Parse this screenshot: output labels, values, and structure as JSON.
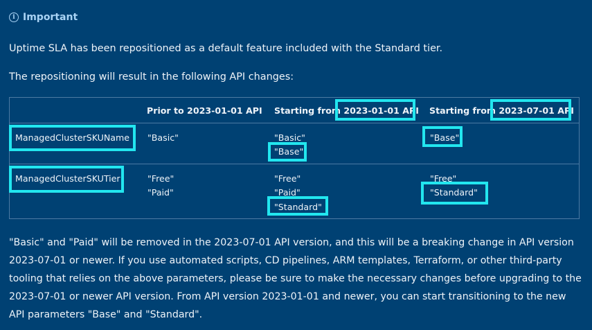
{
  "callout": {
    "icon": "info-circle-icon",
    "title": "Important"
  },
  "intro": "Uptime SLA has been repositioned as a default feature included with the Standard tier.",
  "lead": "The repositioning will result in the following API changes:",
  "table": {
    "headers": [
      "",
      "Prior to 2023-01-01 API",
      "Starting from 2023-01-01 API",
      "Starting from 2023-07-01 API"
    ],
    "header_parts": {
      "col2_prefix": "Starting from ",
      "col2_version": "2023-01-01 API",
      "col3_prefix": "Starting from ",
      "col3_version": "2023-07-01 API"
    },
    "rows": [
      {
        "name": "ManagedClusterSKUName",
        "prior": [
          "\"Basic\""
        ],
        "from_2023_01_01": [
          "\"Basic\"",
          "\"Base\""
        ],
        "from_2023_07_01": [
          "\"Base\""
        ]
      },
      {
        "name": "ManagedClusterSKUTier",
        "prior": [
          "\"Free\"",
          "\"Paid\""
        ],
        "from_2023_01_01": [
          "\"Free\"",
          "\"Paid\"",
          "\"Standard\""
        ],
        "from_2023_07_01": [
          "\"Free\"",
          "\"Standard\""
        ]
      }
    ]
  },
  "closing": "\"Basic\" and \"Paid\" will be removed in the 2023-07-01 API version, and this will be a breaking change in API version 2023-07-01 or newer. If you use automated scripts, CD pipelines, ARM templates, Terraform, or other third-party tooling that relies on the above parameters, please be sure to make the necessary changes before upgrading to the 2023-07-01 or newer API version. From API version 2023-01-01 and newer, you can start transitioning to the new API parameters \"Base\" and \"Standard\".",
  "colors": {
    "background": "#004173",
    "highlight": "#22e6ef",
    "callout_title": "#a9d3f5",
    "table_border": "#4d7aa3"
  }
}
